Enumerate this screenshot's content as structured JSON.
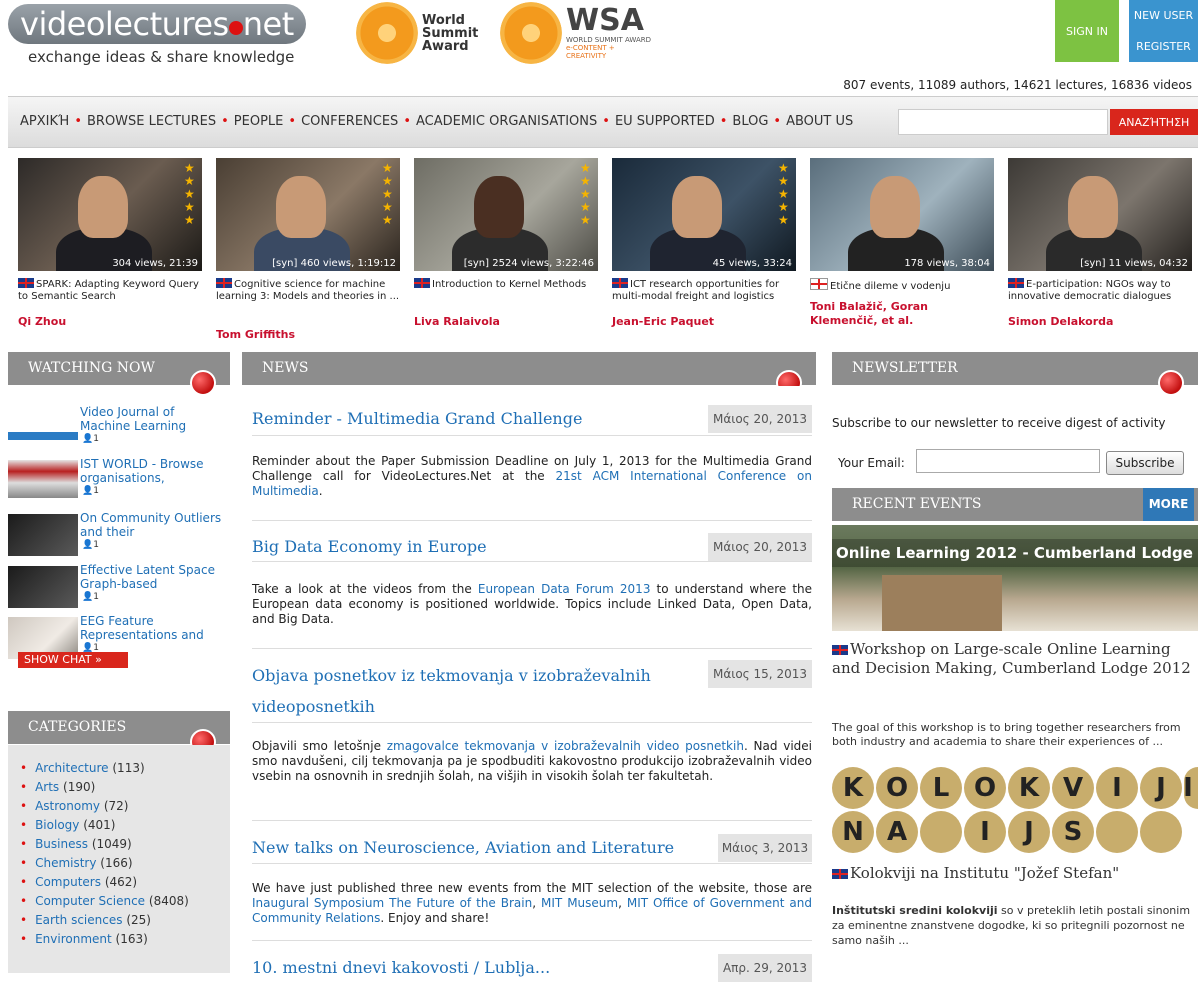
{
  "header": {
    "logo_text": "videolectures",
    "logo_suffix": "net",
    "tagline": "exchange ideas & share knowledge",
    "award1": [
      "World",
      "Summit",
      "Award"
    ],
    "award2_main": "WSA",
    "award2_sub1": "WORLD SUMMIT AWARD",
    "award2_sub2": "e-CONTENT +",
    "award2_sub3": "CREATIVITY",
    "signin": "SIGN IN",
    "new_user": "NEW USER",
    "register": "REGISTER",
    "stats": "807 events, 11089 authors, 14621 lectures, 16836 videos"
  },
  "nav": {
    "items": [
      "ΑΡΧΙΚΉ",
      "BROWSE LECTURES",
      "PEOPLE",
      "CONFERENCES",
      "ACADEMIC ORGANISATIONS",
      "EU SUPPORTED",
      "BLOG",
      "ABOUT US"
    ],
    "search_button": "ΑΝΑΖΉΤΗΣΗ"
  },
  "videos": [
    {
      "stars": "★★★★★",
      "meta": "304 views, 21:39",
      "title": "SPARK: Adapting Keyword Query to Semantic Search",
      "author": "Qi Zhou"
    },
    {
      "stars": "★★★★★",
      "meta": "[syn]  460 views, 1:19:12",
      "title": "Cognitive science for machine learning 3: Models and theories in ...",
      "author": "Tom Griffiths"
    },
    {
      "stars": "★★★★★",
      "meta": "[syn]  2524 views, 3:22:46",
      "title": "Introduction to Kernel Methods",
      "author": "Liva Ralaivola"
    },
    {
      "stars": "★★★★★",
      "meta": "45 views, 33:24",
      "title": "ICT research opportunities for multi-modal freight and logistics",
      "author": "Jean-Eric Paquet"
    },
    {
      "stars": "",
      "meta": "178 views, 38:04",
      "title": "Etične dileme v vodenju",
      "author": "Toni Balažič, Goran Klemenčič, et al."
    },
    {
      "stars": "",
      "meta": "[syn]  11 views, 04:32",
      "title": "E-participation: NGOs way to innovative democratic dialogues",
      "author": "Simon Delakorda"
    }
  ],
  "watching_now": {
    "header": "WATCHING NOW",
    "items": [
      {
        "title": "Video Journal of Machine Learning",
        "count": "1"
      },
      {
        "title": "IST WORLD - Browse organisations,",
        "count": "1"
      },
      {
        "title": "On Community Outliers and their",
        "count": "1"
      },
      {
        "title": "Effective Latent Space Graph-based",
        "count": "1"
      },
      {
        "title": "EEG Feature Representations and",
        "count": "1"
      }
    ],
    "show_chat": "SHOW CHAT »"
  },
  "categories": {
    "header": "CATEGORIES",
    "items": [
      {
        "name": "Architecture",
        "count": "(113)"
      },
      {
        "name": "Arts",
        "count": "(190)"
      },
      {
        "name": "Astronomy",
        "count": "(72)"
      },
      {
        "name": "Biology",
        "count": "(401)"
      },
      {
        "name": "Business",
        "count": "(1049)"
      },
      {
        "name": "Chemistry",
        "count": "(166)"
      },
      {
        "name": "Computers",
        "count": "(462)"
      },
      {
        "name": "Computer Science",
        "count": "(8408)"
      },
      {
        "name": "Earth sciences",
        "count": "(25)"
      },
      {
        "name": "Environment",
        "count": "(163)"
      }
    ]
  },
  "news": {
    "header": "NEWS",
    "items": [
      {
        "title": "Reminder - Multimedia Grand Challenge",
        "date": "Μάιος 20, 2013",
        "body_pre": "Reminder about the Paper Submission Deadline on July 1, 2013 for the Multimedia Grand Challenge call for VideoLectures.Net at the ",
        "link": "21st ACM International Conference on Multimedia",
        "body_post": "."
      },
      {
        "title": "Big Data Economy in Europe",
        "date": "Μάιος 20, 2013",
        "body_pre": "Take a look at the videos from the ",
        "link": "European Data Forum 2013",
        "body_post": " to understand where the European data economy is positioned worldwide. Topics include Linked Data, Open Data, and Big Data."
      },
      {
        "title": "Objava posnetkov iz tekmovanja v izobraževalnih videoposnetkih",
        "date": "Μάιος 15, 2013",
        "body_pre": "Objavili smo letošnje ",
        "link": "zmagovalce tekmovanja v izobraževalnih video posnetkih",
        "body_post": ". Nad videi smo navdušeni, cilj tekmovanja pa je spodbuditi kakovostno produkcijo izobraževalnih video vsebin na osnovnih in srednjih šolah, na višjih in visokih šolah ter fakultetah."
      },
      {
        "title": "New talks on Neuroscience, Aviation and Literature",
        "date": "Μάιος 3, 2013",
        "body_pre": "We have just published three new events from the MIT selection of the website, those are ",
        "link": "Inaugural Symposium The Future of the Brain",
        "link2": "MIT Museum",
        "link3": "MIT Office of Government and Community Relations",
        "body_post": ". Enjoy and share!"
      },
      {
        "title": "10. mestni dnevi kakovosti / Lublja...",
        "date": "Απρ. 29, 2013"
      }
    ]
  },
  "newsletter": {
    "header": "NEWSLETTER",
    "text": "Subscribe to our newsletter to receive digest of activity",
    "email_label": "Your Email:",
    "subscribe": "Subscribe"
  },
  "recent_events": {
    "header": "RECENT EVENTS",
    "more": "MORE",
    "banner": "Online Learning 2012 - Cumberland Lodge",
    "event1_title": "Workshop on Large-scale Online Learning and Decision Making, Cumberland Lodge 2012",
    "event1_desc": "The goal of this workshop is to bring together researchers from both industry and academia to share their experiences of ...",
    "kolo_row1": [
      "K",
      "O",
      "L",
      "O",
      "K",
      "V",
      "I",
      "J",
      "I"
    ],
    "kolo_row2": [
      "N",
      "A",
      "",
      "I",
      "J",
      "S",
      "",
      ""
    ],
    "event2_title": "Kolokviji na Institutu \"Jožef Stefan\"",
    "event2_bold": "Inštitutski sredini kolokviji",
    "event2_desc": " so v preteklih letih postali sinonim za eminentne znanstvene dogodke, ki so pritegnili pozornost ne samo naših ..."
  }
}
